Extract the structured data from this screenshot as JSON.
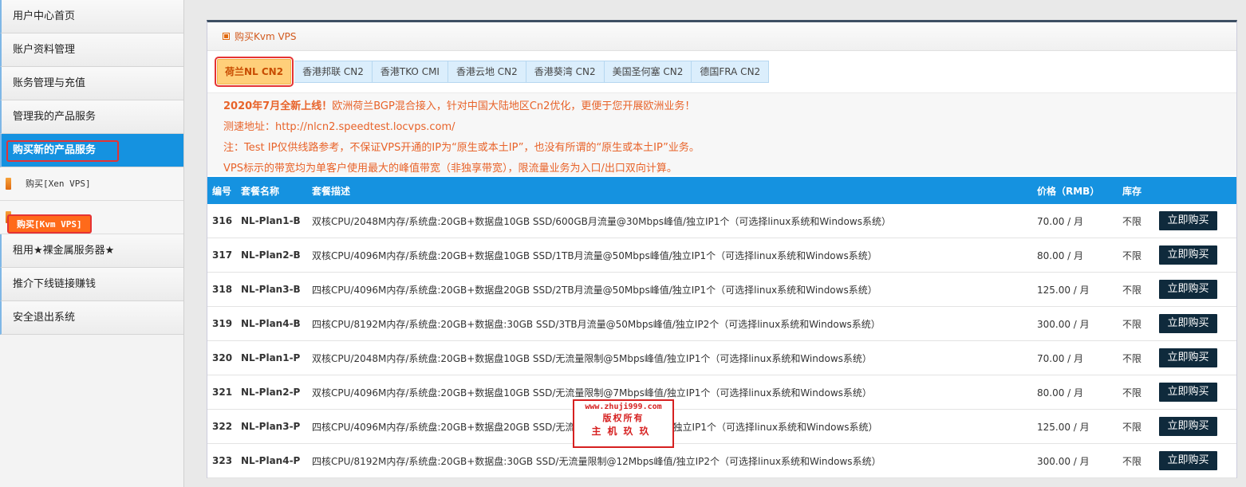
{
  "sidebar": {
    "items": [
      {
        "label": "用户中心首页"
      },
      {
        "label": "账户资料管理"
      },
      {
        "label": "账务管理与充值"
      },
      {
        "label": "管理我的产品服务"
      },
      {
        "label": "购买新的产品服务"
      }
    ],
    "subitems": [
      {
        "label": "购买[Xen VPS]"
      },
      {
        "label": "购买[Kvm VPS]"
      }
    ],
    "items_after": [
      {
        "label": "租用★裸金属服务器★"
      },
      {
        "label": "推介下线链接赚钱"
      },
      {
        "label": "安全退出系统"
      }
    ]
  },
  "panel": {
    "title": "购买Kvm VPS",
    "tabs": [
      {
        "label": "荷兰NL CN2"
      },
      {
        "label": "香港邦联 CN2"
      },
      {
        "label": "香港TKO CMI"
      },
      {
        "label": "香港云地 CN2"
      },
      {
        "label": "香港葵湾 CN2"
      },
      {
        "label": "美国圣何塞 CN2"
      },
      {
        "label": "德国FRA CN2"
      }
    ],
    "notes": {
      "headline": "2020年7月全新上线！",
      "line1_rest": "欧洲荷兰BGP混合接入，针对中国大陆地区Cn2优化，更便于您开展欧洲业务！",
      "line2": "测速地址：http://nlcn2.speedtest.locvps.com/",
      "line3": "注：Test IP仅供线路参考，不保证VPS开通的IP为“原生或本土IP”，也没有所谓的“原生或本土IP”业务。",
      "line4": "VPS标示的带宽均为单客户使用最大的峰值带宽（非独享带宽），限流量业务为入口/出口双向计算。"
    }
  },
  "table": {
    "headers": {
      "id": "编号",
      "name": "套餐名称",
      "desc": "套餐描述",
      "price": "价格（RMB）",
      "stock": "库存",
      "action": ""
    },
    "rows": [
      {
        "id": "316",
        "name": "NL-Plan1-B",
        "desc": "双核CPU/2048M内存/系统盘:20GB+数据盘10GB SSD/600GB月流量@30Mbps峰值/独立IP1个（可选择linux系统和Windows系统）",
        "price": "70.00 / 月",
        "stock": "不限",
        "action": "立即购买"
      },
      {
        "id": "317",
        "name": "NL-Plan2-B",
        "desc": "双核CPU/4096M内存/系统盘:20GB+数据盘10GB SSD/1TB月流量@50Mbps峰值/独立IP1个（可选择linux系统和Windows系统）",
        "price": "80.00 / 月",
        "stock": "不限",
        "action": "立即购买"
      },
      {
        "id": "318",
        "name": "NL-Plan3-B",
        "desc": "四核CPU/4096M内存/系统盘:20GB+数据盘20GB SSD/2TB月流量@50Mbps峰值/独立IP1个（可选择linux系统和Windows系统）",
        "price": "125.00 / 月",
        "stock": "不限",
        "action": "立即购买"
      },
      {
        "id": "319",
        "name": "NL-Plan4-B",
        "desc": "四核CPU/8192M内存/系统盘:20GB+数据盘:30GB SSD/3TB月流量@50Mbps峰值/独立IP2个（可选择linux系统和Windows系统）",
        "price": "300.00 / 月",
        "stock": "不限",
        "action": "立即购买"
      },
      {
        "id": "320",
        "name": "NL-Plan1-P",
        "desc": "双核CPU/2048M内存/系统盘:20GB+数据盘10GB SSD/无流量限制@5Mbps峰值/独立IP1个（可选择linux系统和Windows系统）",
        "price": "70.00 / 月",
        "stock": "不限",
        "action": "立即购买"
      },
      {
        "id": "321",
        "name": "NL-Plan2-P",
        "desc": "双核CPU/4096M内存/系统盘:20GB+数据盘10GB SSD/无流量限制@7Mbps峰值/独立IP1个（可选择linux系统和Windows系统）",
        "price": "80.00 / 月",
        "stock": "不限",
        "action": "立即购买"
      },
      {
        "id": "322",
        "name": "NL-Plan3-P",
        "desc": "四核CPU/4096M内存/系统盘:20GB+数据盘20GB SSD/无流量限制@10Mbps峰值/独立IP1个（可选择linux系统和Windows系统）",
        "price": "125.00 / 月",
        "stock": "不限",
        "action": "立即购买"
      },
      {
        "id": "323",
        "name": "NL-Plan4-P",
        "desc": "四核CPU/8192M内存/系统盘:20GB+数据盘:30GB SSD/无流量限制@12Mbps峰值/独立IP2个（可选择linux系统和Windows系统）",
        "price": "300.00 / 月",
        "stock": "不限",
        "action": "立即购买"
      }
    ]
  },
  "watermark": {
    "line1": "www.zhuji999.com",
    "line2": "版权所有",
    "line3": "主机玖玖"
  }
}
